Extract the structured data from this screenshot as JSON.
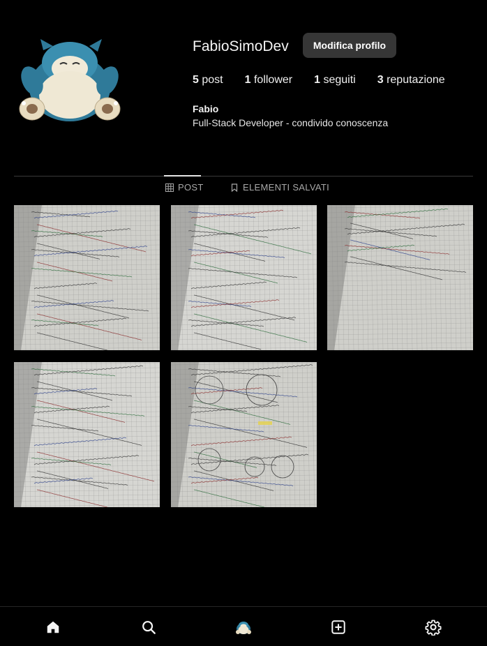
{
  "profile": {
    "username": "FabioSimoDev",
    "edit_button": "Modifica profilo",
    "stats": [
      {
        "count": "5",
        "label": "post"
      },
      {
        "count": "1",
        "label": "follower"
      },
      {
        "count": "1",
        "label": "seguiti"
      },
      {
        "count": "3",
        "label": "reputazione"
      }
    ],
    "full_name": "Fabio",
    "bio": "Full-Stack Developer - condivido conoscenza",
    "avatar_icon": "snorlax-avatar"
  },
  "tabs": [
    {
      "label": "POST",
      "icon": "grid-icon",
      "active": true
    },
    {
      "label": "ELEMENTI SALVATI",
      "icon": "bookmark-icon",
      "active": false
    }
  ],
  "posts": [
    {
      "kind": "notebook-photo"
    },
    {
      "kind": "notebook-photo"
    },
    {
      "kind": "notebook-photo"
    },
    {
      "kind": "notebook-photo"
    },
    {
      "kind": "notebook-photo"
    }
  ],
  "bottom_nav": [
    {
      "icon": "home-icon"
    },
    {
      "icon": "search-icon"
    },
    {
      "icon": "profile-avatar-icon"
    },
    {
      "icon": "add-post-icon"
    },
    {
      "icon": "settings-icon"
    }
  ],
  "colors": {
    "background": "#000000",
    "button_bg": "#363636",
    "divider": "#3a3a3a",
    "muted_text": "#a8a8a8"
  }
}
